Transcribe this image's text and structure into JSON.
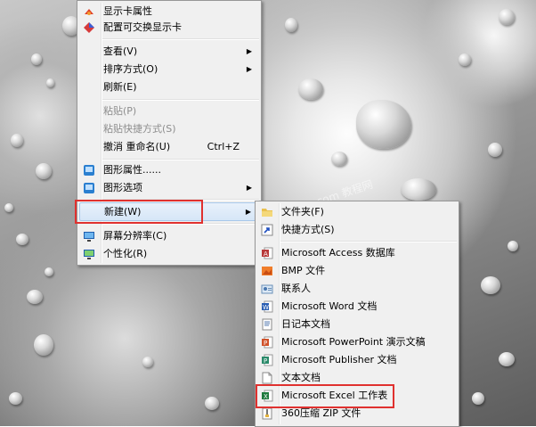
{
  "context_menu": {
    "items": [
      {
        "label": "显示卡属性",
        "icon": "display-card-properties-icon"
      },
      {
        "label": "配置可交换显示卡",
        "icon": "switchable-graphics-icon"
      },
      {
        "label": "查看(V)",
        "submenu": true
      },
      {
        "label": "排序方式(O)",
        "submenu": true
      },
      {
        "label": "刷新(E)"
      },
      {
        "label": "粘贴(P)",
        "disabled": true
      },
      {
        "label": "粘贴快捷方式(S)",
        "disabled": true
      },
      {
        "label": "撤消 重命名(U)",
        "shortcut": "Ctrl+Z"
      },
      {
        "label": "图形属性......",
        "icon": "graphics-properties-icon"
      },
      {
        "label": "图形选项",
        "icon": "graphics-options-icon",
        "submenu": true
      },
      {
        "label": "新建(W)",
        "submenu": true,
        "highlighted": true
      },
      {
        "label": "屏幕分辨率(C)",
        "icon": "screen-resolution-icon"
      },
      {
        "label": "个性化(R)",
        "icon": "personalize-icon"
      }
    ]
  },
  "new_submenu": {
    "items": [
      {
        "label": "文件夹(F)",
        "icon": "folder-icon"
      },
      {
        "label": "快捷方式(S)",
        "icon": "shortcut-icon"
      },
      {
        "label": "Microsoft Access 数据库",
        "icon": "access-icon"
      },
      {
        "label": "BMP 文件",
        "icon": "bmp-icon"
      },
      {
        "label": "联系人",
        "icon": "contact-icon"
      },
      {
        "label": "Microsoft Word 文档",
        "icon": "word-icon"
      },
      {
        "label": "日记本文档",
        "icon": "journal-icon"
      },
      {
        "label": "Microsoft PowerPoint 演示文稿",
        "icon": "powerpoint-icon"
      },
      {
        "label": "Microsoft Publisher 文档",
        "icon": "publisher-icon"
      },
      {
        "label": "文本文档",
        "icon": "text-document-icon"
      },
      {
        "label": "Microsoft Excel 工作表",
        "icon": "excel-icon",
        "highlighted": true
      },
      {
        "label": "360压缩 ZIP 文件",
        "icon": "zip-icon"
      }
    ]
  },
  "watermark": "jiaocheng.dazu.com 教程网",
  "colors": {
    "highlight_box": "#e0312f",
    "menu_bg": "#f0f0f0"
  }
}
